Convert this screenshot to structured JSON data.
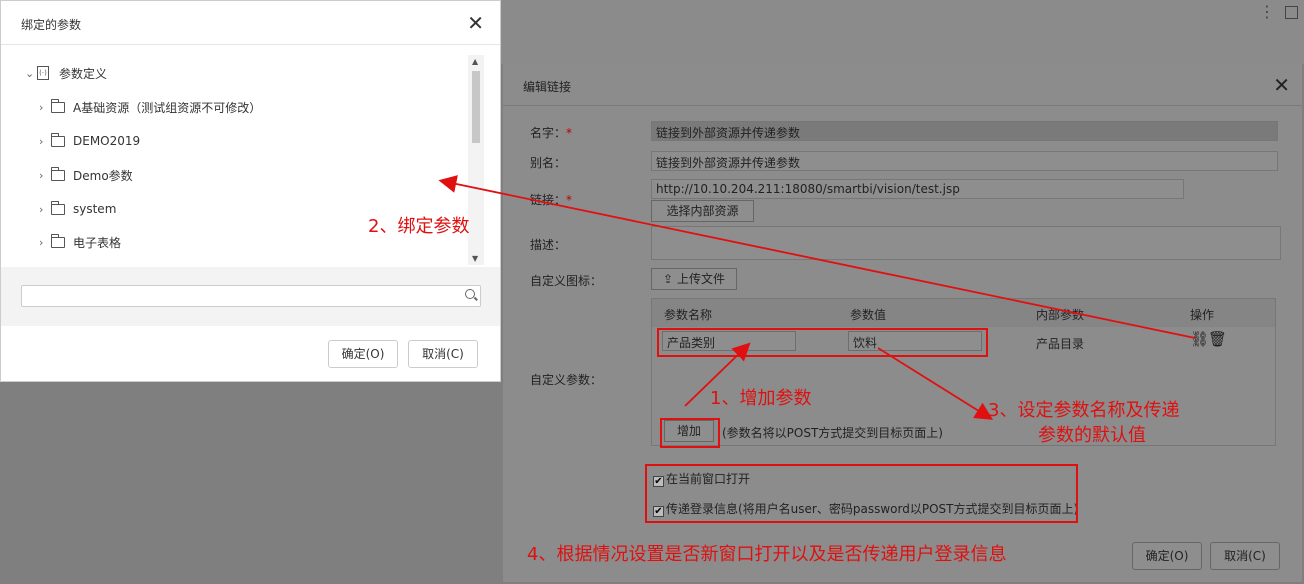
{
  "bind_dialog": {
    "title": "绑定的参数",
    "tree": {
      "root": "参数定义",
      "items": [
        "A基础资源（测试组资源不可修改）",
        "DEMO2019",
        "Demo参数",
        "system",
        "电子表格"
      ]
    },
    "search_placeholder": "",
    "ok_label": "确定(O)",
    "cancel_label": "取消(C)"
  },
  "edit_dialog": {
    "title": "编辑链接",
    "name_label": "名字：",
    "name_value": "链接到外部资源并传递参数",
    "alias_label": "别名：",
    "alias_value": "链接到外部资源并传递参数",
    "link_label": "链接：",
    "link_value": "http://10.10.204.211:18080/smartbi/vision/test.jsp",
    "select_internal_label": "选择内部资源",
    "desc_label": "描述：",
    "icon_label": "自定义图标：",
    "upload_label": "上传文件",
    "params_label": "自定义参数：",
    "params_table": {
      "headers": [
        "参数名称",
        "参数值",
        "内部参数",
        "操作"
      ],
      "rows": [
        {
          "name": "产品类别",
          "value": "饮料",
          "internal": "产品目录"
        }
      ]
    },
    "add_label": "增加",
    "add_note": "(参数名将以POST方式提交到目标页面上)",
    "open_current_label": "在当前窗口打开",
    "pass_login_label": "传递登录信息(将用户名user、密码password以POST方式提交到目标页面上)",
    "ok_label": "确定(O)",
    "cancel_label": "取消(C)"
  },
  "annotations": {
    "a1": "1、增加参数",
    "a2": "2、绑定参数",
    "a3_line1": "3、设定参数名称及传递",
    "a3_line2": "参数的默认值",
    "a4": "4、根据情况设置是否新窗口打开以及是否传递用户登录信息"
  },
  "colors": {
    "annotation": "#e01010"
  }
}
